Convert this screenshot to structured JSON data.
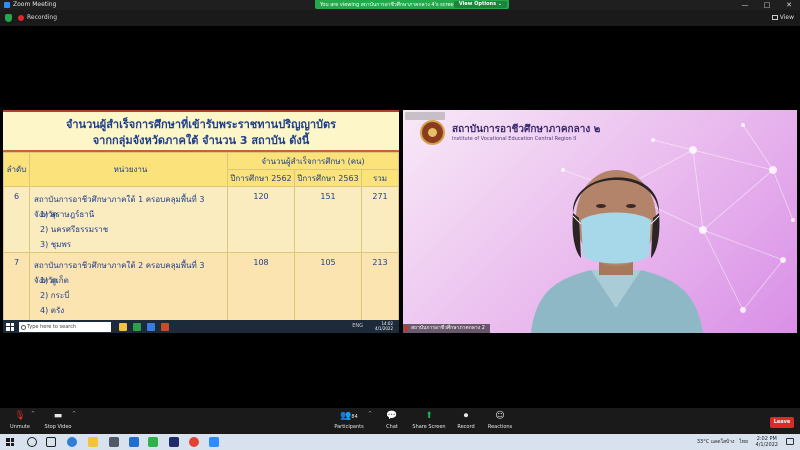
{
  "window": {
    "title": "Zoom Meeting",
    "share_banner": "You are viewing สถาบันการอาชีวศึกษาภาคกลาง 4's screen",
    "view_options": "View Options ⌄",
    "controls": [
      "—",
      "□",
      "✕"
    ]
  },
  "topbar": {
    "recording_label": "Recording",
    "view_label": "View"
  },
  "slide": {
    "title_line1": "จำนวนผู้สำเร็จการศึกษาที่เข้ารับพระราชทานปริญญาบัตร",
    "title_line2": "จากกลุ่มจังหวัดภาคใต้ จำนวน 3 สถาบัน ดังนี้",
    "table": {
      "col_no": "ลำดับ",
      "col_unit": "หน่วยงาน",
      "col_group": "จำนวนผู้สำเร็จการศึกษา (คน)",
      "col_y1": "ปีการศึกษา 2562",
      "col_y2": "ปีการศึกษา 2563",
      "col_total": "รวม",
      "rows": [
        {
          "no": "6",
          "unit": "สถาบันการอาชีวศึกษาภาคใต้ 1 ครอบคลุมพื้นที่ 3 จังหวัด",
          "sub": [
            "1) สุราษฎร์ธานี",
            "2) นครศรีธรรมราช",
            "3) ชุมพร"
          ],
          "y1": "120",
          "y2": "151",
          "total": "271"
        },
        {
          "no": "7",
          "unit": "สถาบันการอาชีวศึกษาภาคใต้ 2 ครอบคลุมพื้นที่ 3 จังหวัด",
          "sub": [
            "1) ภูเก็ต",
            "2) กระบี่",
            "4) ตรัง"
          ],
          "y1": "108",
          "y2": "105",
          "total": "213"
        }
      ]
    }
  },
  "remote_taskbar": {
    "search_placeholder": "Type here to search",
    "tray": "ENG",
    "time": "14:02",
    "date": "4/1/2022"
  },
  "camera": {
    "institute_name": "สถาบันการอาชีวศึกษาภาคกลาง ๒",
    "institute_sub": "Institute of Vocational Education Central Region II",
    "participant_label": "สถาบันการอาชีวศึกษาภาคกลาง 2"
  },
  "controls": {
    "unmute": "Unmute",
    "stop_video": "Stop Video",
    "participants_count": "84",
    "participants": "Participants",
    "chat": "Chat",
    "share_screen": "Share Screen",
    "record": "Record",
    "reactions": "Reactions",
    "leave": "Leave"
  },
  "taskbar": {
    "weather": "33°C",
    "weather_desc": "แดดใสบ้าง",
    "lang": "ไทย",
    "time": "2:02 PM",
    "date": "4/1/2022"
  },
  "colors": {
    "share_green": "#23a94b",
    "leave_red": "#e02828",
    "table_header": "#fbe27a",
    "table_text": "#1d3f8b"
  }
}
